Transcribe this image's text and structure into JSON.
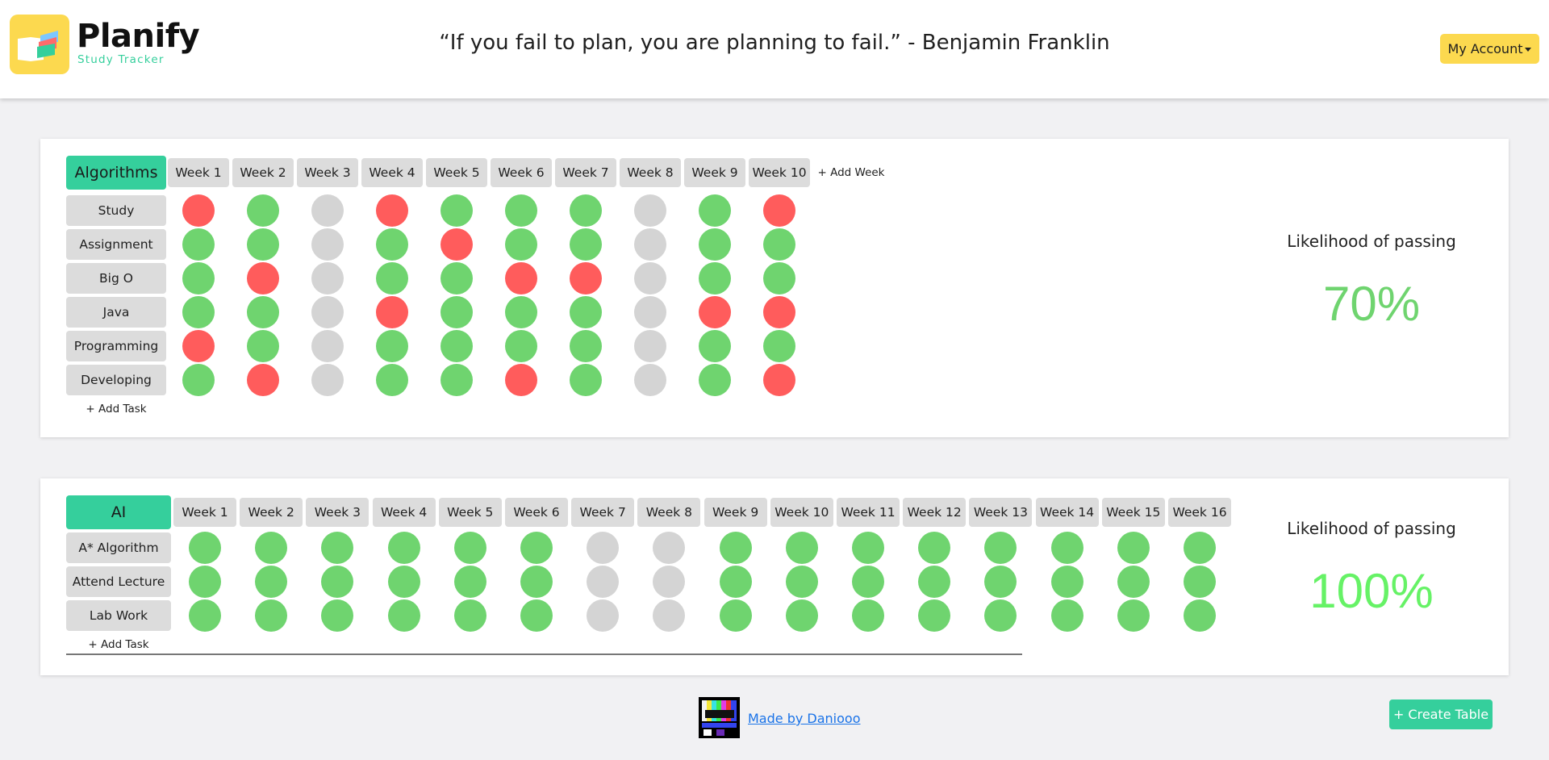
{
  "header": {
    "brand_name": "Planify",
    "brand_sub": "Study Tracker",
    "quote": "“If you fail to plan, you are planning to fail.” - Benjamin Franklin",
    "account_label": "My Account"
  },
  "tables": [
    {
      "subject": "Algorithms",
      "weeks": [
        "Week 1",
        "Week 2",
        "Week 3",
        "Week 4",
        "Week 5",
        "Week 6",
        "Week 7",
        "Week 8",
        "Week 9",
        "Week 10"
      ],
      "add_week_label": "+ Add Week",
      "tasks": [
        {
          "label": "Study",
          "status": [
            "r",
            "g",
            "x",
            "r",
            "g",
            "g",
            "g",
            "x",
            "g",
            "r"
          ]
        },
        {
          "label": "Assignment",
          "status": [
            "g",
            "g",
            "x",
            "g",
            "r",
            "g",
            "g",
            "x",
            "g",
            "g"
          ]
        },
        {
          "label": "Big O",
          "status": [
            "g",
            "r",
            "x",
            "g",
            "g",
            "r",
            "r",
            "x",
            "g",
            "g"
          ]
        },
        {
          "label": "Java",
          "status": [
            "g",
            "g",
            "x",
            "r",
            "g",
            "g",
            "g",
            "x",
            "r",
            "r"
          ]
        },
        {
          "label": "Programming",
          "status": [
            "r",
            "g",
            "x",
            "g",
            "g",
            "g",
            "g",
            "x",
            "g",
            "g"
          ]
        },
        {
          "label": "Developing",
          "status": [
            "g",
            "r",
            "x",
            "g",
            "g",
            "r",
            "g",
            "x",
            "g",
            "r"
          ]
        }
      ],
      "add_task_label": "+ Add Task",
      "likelihood_label": "Likelihood of passing",
      "likelihood_value": "70%",
      "likelihood_color": "#6fd46f"
    },
    {
      "subject": "AI",
      "weeks": [
        "Week 1",
        "Week 2",
        "Week 3",
        "Week 4",
        "Week 5",
        "Week 6",
        "Week 7",
        "Week 8",
        "Week 9",
        "Week 10",
        "Week 11",
        "Week 12",
        "Week 13",
        "Week 14",
        "Week 15",
        "Week 16"
      ],
      "add_week_label": "",
      "tasks": [
        {
          "label": "A* Algorithm",
          "status": [
            "g",
            "g",
            "g",
            "g",
            "g",
            "g",
            "x",
            "x",
            "g",
            "g",
            "g",
            "g",
            "g",
            "g",
            "g",
            "g"
          ]
        },
        {
          "label": "Attend Lecture",
          "status": [
            "g",
            "g",
            "g",
            "g",
            "g",
            "g",
            "x",
            "x",
            "g",
            "g",
            "g",
            "g",
            "g",
            "g",
            "g",
            "g"
          ]
        },
        {
          "label": "Lab Work",
          "status": [
            "g",
            "g",
            "g",
            "g",
            "g",
            "g",
            "x",
            "x",
            "g",
            "g",
            "g",
            "g",
            "g",
            "g",
            "g",
            "g"
          ]
        }
      ],
      "add_task_label": "+ Add Task",
      "likelihood_label": "Likelihood of passing",
      "likelihood_value": "100%",
      "likelihood_color": "#66f266"
    }
  ],
  "footer": {
    "made_by": "Made by Daniooo",
    "create_table_label": "+ Create Table"
  },
  "colors": {
    "accent_green": "#35cf9c",
    "accent_yellow": "#fcd94f",
    "status_done": "#6fd46f",
    "status_missed": "#ff5c5c",
    "status_none": "#d4d4d4"
  }
}
